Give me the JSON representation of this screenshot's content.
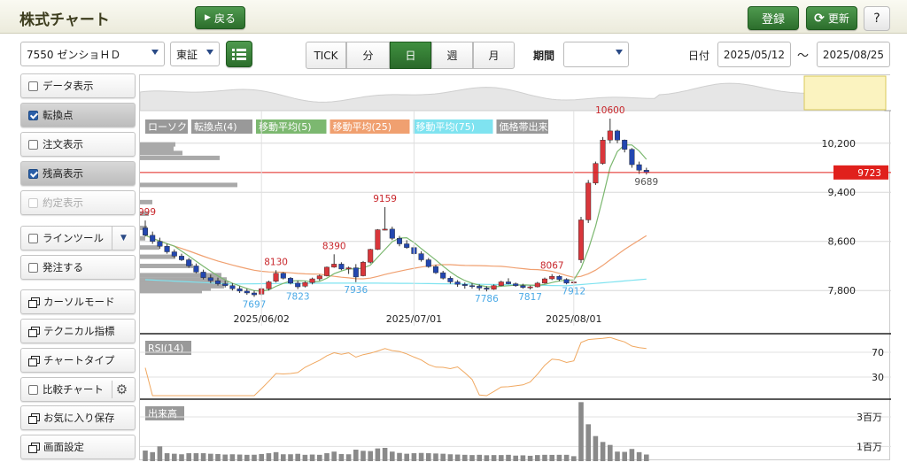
{
  "header": {
    "title": "株式チャート",
    "back_label": "戻る",
    "register_label": "登録",
    "refresh_label": "更新",
    "help_label": "?"
  },
  "toolbar": {
    "stock_select": "7550 ゼンショＨＤ",
    "market_select": "東証",
    "intervals": [
      "TICK",
      "分",
      "日",
      "週",
      "月"
    ],
    "active_interval": "日",
    "period_label": "期間",
    "period_value": "",
    "date_label": "日付",
    "date_from": "2025/05/12",
    "date_sep": "～",
    "date_to": "2025/08/25"
  },
  "sidebar": {
    "items": [
      {
        "label": "データ表示",
        "kind": "checkbox",
        "checked": false
      },
      {
        "label": "転換点",
        "kind": "checkbox",
        "checked": true
      },
      {
        "label": "注文表示",
        "kind": "checkbox",
        "checked": false
      },
      {
        "label": "残高表示",
        "kind": "checkbox",
        "checked": true
      },
      {
        "label": "約定表示",
        "kind": "checkbox",
        "checked": false,
        "disabled": true
      },
      {
        "label": "ラインツール",
        "kind": "checkbox-dropdown",
        "checked": false
      },
      {
        "label": "発注する",
        "kind": "checkbox",
        "checked": false
      },
      {
        "label": "カーソルモード",
        "kind": "window"
      },
      {
        "label": "テクニカル指標",
        "kind": "window"
      },
      {
        "label": "チャートタイプ",
        "kind": "window"
      },
      {
        "label": "比較チャート",
        "kind": "checkbox-gear",
        "checked": false
      },
      {
        "label": "お気に入り保存",
        "kind": "window"
      },
      {
        "label": "画面設定",
        "kind": "window"
      }
    ]
  },
  "colors": {
    "up": "#d9363b",
    "down": "#2347b0",
    "ma5": "#7cb870",
    "ma25": "#f0a070",
    "ma75": "#7fe3f0",
    "rsi": "#f0a860",
    "current_price": "#e0201c",
    "accent_green": "#2c6e2c"
  },
  "chart_data": {
    "type": "candlestick",
    "legend": [
      "ローソク",
      "転換点(4)",
      "移動平均(5)",
      "移動平均(25)",
      "移動平均(75)",
      "価格帯出来"
    ],
    "y_axis": {
      "ticks": [
        7800,
        8600,
        9400,
        10200
      ],
      "range": [
        7630,
        10730
      ]
    },
    "x_axis": {
      "labels": [
        "2025/06/02",
        "2025/07/01",
        "2025/08/01"
      ]
    },
    "current_price": 9723,
    "turning_points": [
      {
        "text": "999",
        "kind": "high"
      },
      {
        "text": "7697",
        "kind": "low"
      },
      {
        "text": "8130",
        "kind": "high"
      },
      {
        "text": "7823",
        "kind": "low"
      },
      {
        "text": "8390",
        "kind": "high"
      },
      {
        "text": "7936",
        "kind": "low"
      },
      {
        "text": "9159",
        "kind": "high"
      },
      {
        "text": "7786",
        "kind": "low"
      },
      {
        "text": "8067",
        "kind": "high"
      },
      {
        "text": "7817",
        "kind": "low"
      },
      {
        "text": "7912",
        "kind": "low"
      },
      {
        "text": "10600",
        "kind": "high"
      },
      {
        "text": "9689",
        "kind": "low"
      }
    ],
    "candles": [
      [
        8820,
        8940,
        8680,
        8700
      ],
      [
        8700,
        8760,
        8560,
        8600
      ],
      [
        8600,
        8660,
        8480,
        8520
      ],
      [
        8520,
        8560,
        8400,
        8430
      ],
      [
        8430,
        8470,
        8330,
        8360
      ],
      [
        8360,
        8400,
        8280,
        8300
      ],
      [
        8300,
        8330,
        8170,
        8200
      ],
      [
        8200,
        8240,
        8080,
        8100
      ],
      [
        8100,
        8140,
        7980,
        8010
      ],
      [
        8010,
        8060,
        7920,
        7960
      ],
      [
        7960,
        8010,
        7880,
        7910
      ],
      [
        7910,
        7960,
        7850,
        7880
      ],
      [
        7880,
        7920,
        7800,
        7830
      ],
      [
        7830,
        7870,
        7760,
        7790
      ],
      [
        7790,
        7830,
        7730,
        7760
      ],
      [
        7760,
        7800,
        7697,
        7730
      ],
      [
        7740,
        7850,
        7720,
        7830
      ],
      [
        7830,
        7960,
        7800,
        7940
      ],
      [
        7950,
        8130,
        7930,
        8080
      ],
      [
        8080,
        8100,
        7980,
        8000
      ],
      [
        8000,
        8020,
        7900,
        7920
      ],
      [
        7920,
        7960,
        7823,
        7860
      ],
      [
        7870,
        7950,
        7850,
        7930
      ],
      [
        7930,
        8010,
        7900,
        7990
      ],
      [
        7990,
        8060,
        7960,
        8040
      ],
      [
        8040,
        8190,
        8030,
        8180
      ],
      [
        8180,
        8390,
        8170,
        8230
      ],
      [
        8230,
        8260,
        8130,
        8150
      ],
      [
        8150,
        8190,
        8070,
        8170
      ],
      [
        8170,
        8230,
        7936,
        8020
      ],
      [
        8040,
        8280,
        8030,
        8260
      ],
      [
        8260,
        8480,
        8240,
        8470
      ],
      [
        8470,
        8800,
        8460,
        8790
      ],
      [
        8790,
        9159,
        8780,
        8800
      ],
      [
        8800,
        8840,
        8620,
        8650
      ],
      [
        8650,
        8690,
        8520,
        8560
      ],
      [
        8560,
        8620,
        8480,
        8500
      ],
      [
        8500,
        8540,
        8380,
        8400
      ],
      [
        8400,
        8440,
        8270,
        8300
      ],
      [
        8300,
        8330,
        8170,
        8190
      ],
      [
        8190,
        8220,
        8070,
        8090
      ],
      [
        8090,
        8120,
        7980,
        8000
      ],
      [
        8000,
        8030,
        7910,
        7940
      ],
      [
        7940,
        7970,
        7860,
        7900
      ],
      [
        7900,
        7930,
        7830,
        7880
      ],
      [
        7880,
        7920,
        7830,
        7870
      ],
      [
        7870,
        7900,
        7800,
        7840
      ],
      [
        7840,
        7870,
        7786,
        7820
      ],
      [
        7820,
        7900,
        7810,
        7880
      ],
      [
        7880,
        7960,
        7870,
        7940
      ],
      [
        7940,
        8000,
        7900,
        7910
      ],
      [
        7910,
        7930,
        7860,
        7880
      ],
      [
        7880,
        7910,
        7830,
        7850
      ],
      [
        7850,
        7880,
        7817,
        7860
      ],
      [
        7860,
        7940,
        7850,
        7920
      ],
      [
        7920,
        8010,
        7910,
        7990
      ],
      [
        7990,
        8067,
        7970,
        8030
      ],
      [
        8030,
        8050,
        7950,
        7980
      ],
      [
        7980,
        8000,
        7900,
        7920
      ],
      [
        7930,
        7960,
        7912,
        7940
      ],
      [
        8300,
        9000,
        8250,
        8950
      ],
      [
        8950,
        9600,
        8900,
        9550
      ],
      [
        9550,
        9900,
        9520,
        9870
      ],
      [
        9870,
        10300,
        9850,
        10250
      ],
      [
        10250,
        10600,
        10200,
        10400
      ],
      [
        10400,
        10420,
        10200,
        10250
      ],
      [
        10250,
        10260,
        10050,
        10100
      ],
      [
        10100,
        10120,
        9800,
        9850
      ],
      [
        9850,
        9900,
        9700,
        9760
      ],
      [
        9760,
        9800,
        9689,
        9723
      ]
    ],
    "rsi": {
      "label": "RSI(14)",
      "ticks": [
        70,
        30
      ],
      "range": [
        0,
        100
      ]
    },
    "volume": {
      "label": "出来高",
      "ticks": [
        "3百万",
        "1百万"
      ],
      "tick_values": [
        3000000,
        1000000
      ],
      "range": [
        0,
        4200000
      ]
    }
  }
}
